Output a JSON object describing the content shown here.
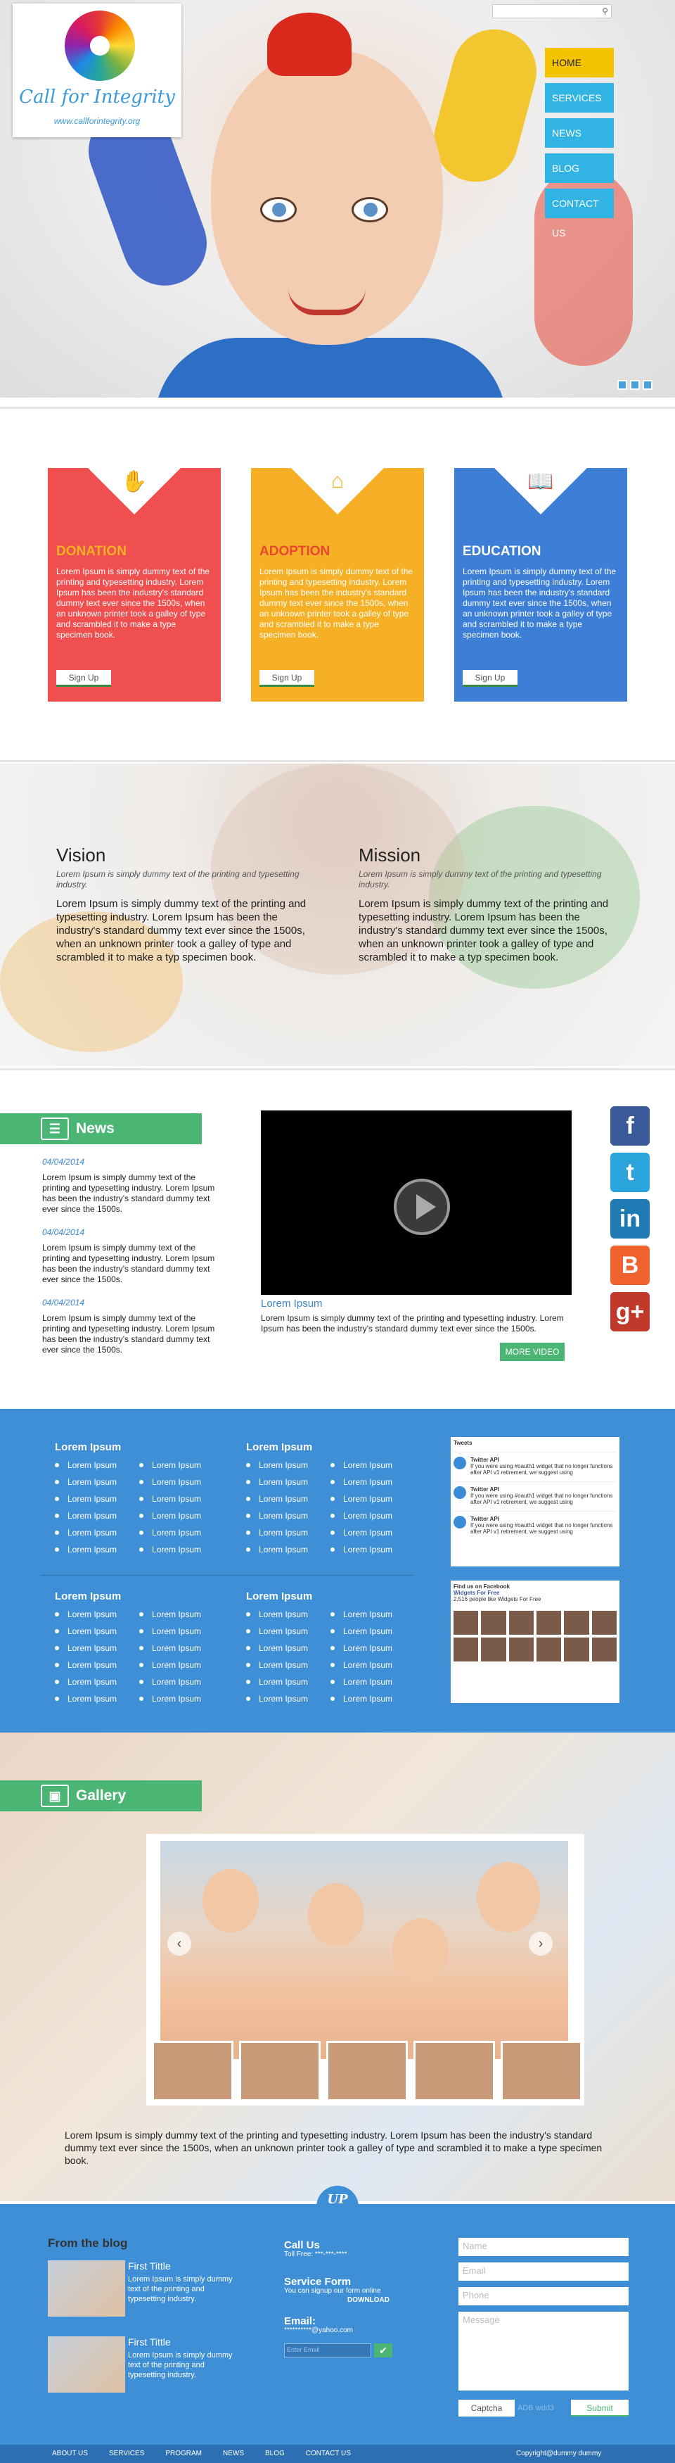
{
  "header": {
    "logo_name": "Call for Integrity",
    "logo_url": "www.callforintegrity.org",
    "search_placeholder": "",
    "nav": [
      "HOME",
      "SERVICES",
      "NEWS",
      "BLOG",
      "CONTACT US"
    ],
    "nav_active": "HOME"
  },
  "cards": [
    {
      "title": "DONATION",
      "text": "Lorem Ipsum is simply dummy text of the printing and typesetting industry. Lorem Ipsum has been the industry's standard dummy text ever since the 1500s, when an unknown printer took a galley of type and scrambled it to make a type specimen book.",
      "button": "Sign Up",
      "icon": "hands-icon"
    },
    {
      "title": "ADOPTION",
      "text": "Lorem Ipsum is simply dummy text of the printing and typesetting industry. Lorem Ipsum has been the industry's standard dummy text ever since the 1500s, when an unknown printer took a galley of type and scrambled it to make a type specimen book.",
      "button": "Sign Up",
      "icon": "home-heart-icon"
    },
    {
      "title": "EDUCATION",
      "text": "Lorem Ipsum is simply dummy text of the printing and typesetting industry. Lorem Ipsum has been the industry's standard dummy text ever since the 1500s, when an unknown printer took a galley of type and scrambled it to make a type specimen book.",
      "button": "Sign Up",
      "icon": "book-icon"
    }
  ],
  "vision": {
    "title": "Vision",
    "sub": "Lorem Ipsum is simply dummy text of the printing and typesetting industry.",
    "text": "Lorem Ipsum is simply dummy text of the printing and typesetting industry. Lorem Ipsum has been the industry's standard dummy text ever since the 1500s, when an unknown printer took a galley of type and scrambled it to make a typ  specimen book."
  },
  "mission": {
    "title": "Mission",
    "sub": "Lorem Ipsum is simply dummy text of the printing and typesetting industry.",
    "text": "Lorem Ipsum is simply dummy text of the printing and typesetting industry. Lorem Ipsum has been the industry's standard dummy text ever since the 1500s, when an unknown printer took a galley of type and scrambled it to make a typ  specimen book."
  },
  "news": {
    "heading": "News",
    "items": [
      {
        "date": "04/04/2014",
        "text": "Lorem Ipsum is simply dummy text of the printing and typesetting industry. Lorem Ipsum has been the industry's standard dummy text ever since the 1500s."
      },
      {
        "date": "04/04/2014",
        "text": "Lorem Ipsum is simply dummy text of the printing and typesetting industry. Lorem Ipsum has been the industry's standard dummy text ever since the 1500s."
      },
      {
        "date": "04/04/2014",
        "text": "Lorem Ipsum is simply dummy text of the printing and typesetting industry. Lorem Ipsum has been the industry's standard dummy text ever since the 1500s."
      }
    ]
  },
  "video": {
    "title": "Lorem Ipsum",
    "text": "Lorem Ipsum is simply dummy text of the printing and typesetting industry. Lorem Ipsum has been the industry's standard dummy text ever since the 1500s.",
    "button": "MORE VIDEO"
  },
  "social": [
    {
      "name": "facebook-icon",
      "glyph": "f",
      "color": "#3b5a9a"
    },
    {
      "name": "twitter-icon",
      "glyph": "t",
      "color": "#2aa4db"
    },
    {
      "name": "linkedin-icon",
      "glyph": "in",
      "color": "#1d7ab3"
    },
    {
      "name": "blogger-icon",
      "glyph": "B",
      "color": "#f0632f"
    },
    {
      "name": "googleplus-icon",
      "glyph": "g+",
      "color": "#c0392b"
    }
  ],
  "links": {
    "heading": "Lorem Ipsum",
    "item": "Lorem Ipsum"
  },
  "widgets": {
    "tweets_title": "Tweets",
    "tweet_user": "Twitter API",
    "tweet_text": "If you were using #oauth1 widget that no longer functions after API v1 retirement, we suggest using",
    "fb_title": "Find us on Facebook",
    "fb_page": "Widgets For Free",
    "fb_likes": "2,516 people like Widgets For Free"
  },
  "gallery": {
    "heading": "Gallery",
    "text": "Lorem Ipsum is simply dummy text of the printing and typesetting industry. Lorem Ipsum has been the industry's standard dummy text ever since the 1500s, when an unknown printer took a galley of type and scrambled it to make a type specimen book."
  },
  "footer": {
    "badge": "UP",
    "blog_heading": "From the blog",
    "posts": [
      {
        "title": "First Tittle",
        "text": "Lorem Ipsum is simply dummy text of the printing and typesetting industry."
      },
      {
        "title": "First Tittle",
        "text": "Lorem Ipsum is simply dummy text of the printing and typesetting industry."
      }
    ],
    "call_title": "Call Us",
    "call_text": "Toll Free: ***-***-****",
    "service_title": "Service Form",
    "service_text": "You can signup our form online",
    "download": "DOWNLOAD",
    "email_title": "Email:",
    "email_value": "**********@yahoo.com",
    "subscribe_placeholder": "Enter Email",
    "form": {
      "name": "Name",
      "email": "Email",
      "phone": "Phone",
      "message": "Message",
      "captcha": "Captcha",
      "captcha_input": "ADB wdd3",
      "submit": "Submit"
    },
    "menu": [
      "ABOUT US",
      "SERVICES",
      "PROGRAM",
      "NEWS",
      "BLOG",
      "CONTACT US"
    ],
    "copyright": "Copyright@dummy dummy"
  }
}
